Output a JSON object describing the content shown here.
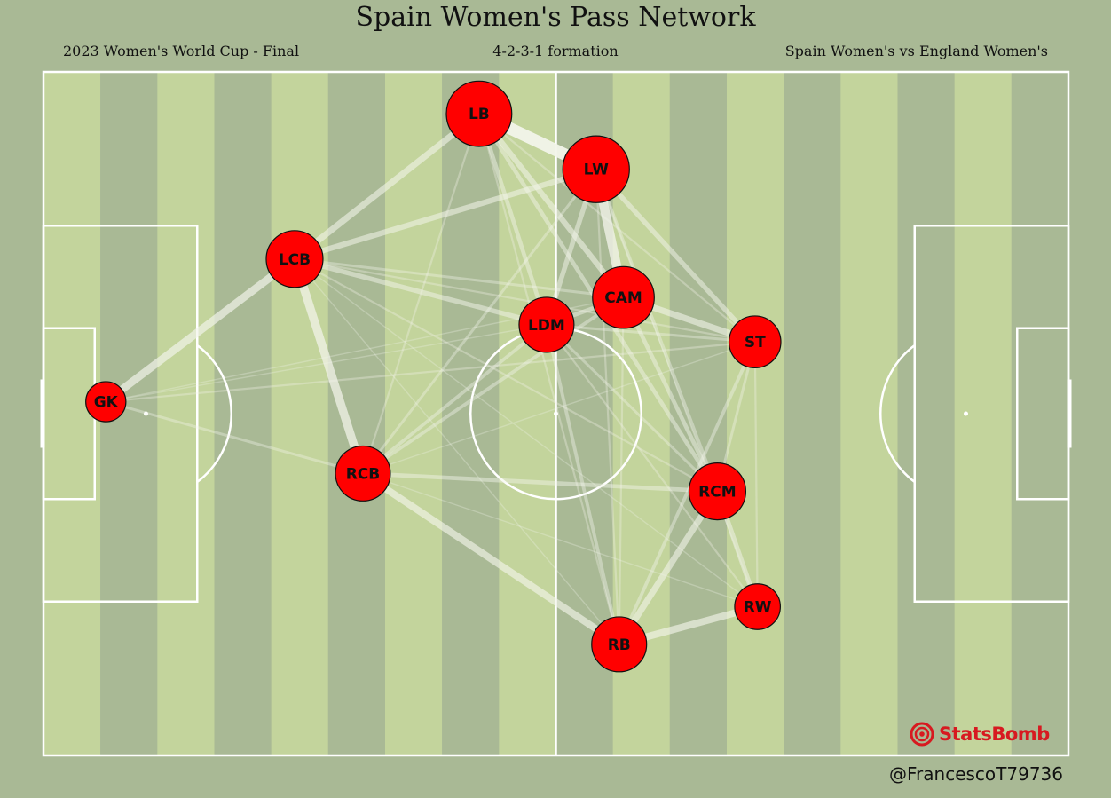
{
  "header": {
    "title": "Spain Women's Pass Network",
    "subtitle_left": "2023 Women's World Cup - Final",
    "subtitle_center": "4-2-3-1 formation",
    "subtitle_right": "Spain Women's vs England Women's"
  },
  "footer": {
    "credit": "@FrancescoT79736",
    "brand": "StatsBomb"
  },
  "colors": {
    "background": "#a9b995",
    "stripe_light": "#c3d49c",
    "stripe_dark": "#a9b995",
    "lines": "#ffffff",
    "node_fill": "#ff0000",
    "edge": "#f2f4ea",
    "brand": "#d71920"
  },
  "chart_data": {
    "type": "network",
    "pitch": {
      "length": 120,
      "width": 80
    },
    "players": [
      {
        "pos": "GK",
        "x": 7.3,
        "y": 38.6,
        "size": 0.35
      },
      {
        "pos": "LCB",
        "x": 29.4,
        "y": 21.9,
        "size": 0.62
      },
      {
        "pos": "RCB",
        "x": 37.4,
        "y": 47.0,
        "size": 0.59
      },
      {
        "pos": "LB",
        "x": 51.0,
        "y": 4.9,
        "size": 0.76
      },
      {
        "pos": "LDM",
        "x": 58.9,
        "y": 29.6,
        "size": 0.59
      },
      {
        "pos": "LW",
        "x": 64.7,
        "y": 11.4,
        "size": 0.78
      },
      {
        "pos": "CAM",
        "x": 67.9,
        "y": 26.4,
        "size": 0.7
      },
      {
        "pos": "RB",
        "x": 67.4,
        "y": 67.0,
        "size": 0.59
      },
      {
        "pos": "ST",
        "x": 83.3,
        "y": 31.6,
        "size": 0.54
      },
      {
        "pos": "RCM",
        "x": 78.9,
        "y": 49.1,
        "size": 0.62
      },
      {
        "pos": "RW",
        "x": 83.6,
        "y": 62.6,
        "size": 0.44
      }
    ],
    "links": [
      {
        "from": "LB",
        "to": "LW",
        "count": 16
      },
      {
        "from": "LW",
        "to": "CAM",
        "count": 12
      },
      {
        "from": "LCB",
        "to": "RCB",
        "count": 11
      },
      {
        "from": "GK",
        "to": "LCB",
        "count": 10
      },
      {
        "from": "RCB",
        "to": "RB",
        "count": 9
      },
      {
        "from": "RB",
        "to": "RW",
        "count": 9
      },
      {
        "from": "LCB",
        "to": "LB",
        "count": 8
      },
      {
        "from": "RB",
        "to": "RCM",
        "count": 8
      },
      {
        "from": "CAM",
        "to": "ST",
        "count": 8
      },
      {
        "from": "LCB",
        "to": "LW",
        "count": 7
      },
      {
        "from": "LB",
        "to": "CAM",
        "count": 7
      },
      {
        "from": "LW",
        "to": "ST",
        "count": 6
      },
      {
        "from": "LCB",
        "to": "LDM",
        "count": 6
      },
      {
        "from": "LW",
        "to": "LDM",
        "count": 6
      },
      {
        "from": "RCM",
        "to": "RW",
        "count": 6
      },
      {
        "from": "LB",
        "to": "RCM",
        "count": 5
      },
      {
        "from": "LB",
        "to": "LDM",
        "count": 5
      },
      {
        "from": "RCB",
        "to": "RCM",
        "count": 5
      },
      {
        "from": "LDM",
        "to": "CAM",
        "count": 5
      },
      {
        "from": "CAM",
        "to": "RCM",
        "count": 5
      },
      {
        "from": "LW",
        "to": "RCM",
        "count": 4
      },
      {
        "from": "RCB",
        "to": "LDM",
        "count": 4
      },
      {
        "from": "RCB",
        "to": "CAM",
        "count": 4
      },
      {
        "from": "LDM",
        "to": "RB",
        "count": 4
      },
      {
        "from": "ST",
        "to": "RB",
        "count": 4
      },
      {
        "from": "ST",
        "to": "RCM",
        "count": 3
      },
      {
        "from": "LDM",
        "to": "RCM",
        "count": 3
      },
      {
        "from": "GK",
        "to": "RCB",
        "count": 3
      },
      {
        "from": "LCB",
        "to": "CAM",
        "count": 3
      },
      {
        "from": "LDM",
        "to": "ST",
        "count": 3
      },
      {
        "from": "RCB",
        "to": "LW",
        "count": 3
      },
      {
        "from": "RCB",
        "to": "LB",
        "count": 2
      },
      {
        "from": "CAM",
        "to": "RB",
        "count": 2
      },
      {
        "from": "LCB",
        "to": "ST",
        "count": 2
      },
      {
        "from": "LCB",
        "to": "RCM",
        "count": 2
      },
      {
        "from": "LB",
        "to": "RB",
        "count": 2
      },
      {
        "from": "LB",
        "to": "ST",
        "count": 2
      },
      {
        "from": "GK",
        "to": "ST",
        "count": 2
      },
      {
        "from": "ST",
        "to": "RW",
        "count": 2
      },
      {
        "from": "LW",
        "to": "RB",
        "count": 2
      },
      {
        "from": "LDM",
        "to": "RW",
        "count": 2
      },
      {
        "from": "GK",
        "to": "CAM",
        "count": 1
      },
      {
        "from": "GK",
        "to": "LDM",
        "count": 1
      },
      {
        "from": "LCB",
        "to": "RB",
        "count": 1
      },
      {
        "from": "LCB",
        "to": "RW",
        "count": 1
      },
      {
        "from": "RCB",
        "to": "ST",
        "count": 1
      },
      {
        "from": "RCB",
        "to": "RW",
        "count": 1
      },
      {
        "from": "LW",
        "to": "RW",
        "count": 1
      }
    ]
  }
}
